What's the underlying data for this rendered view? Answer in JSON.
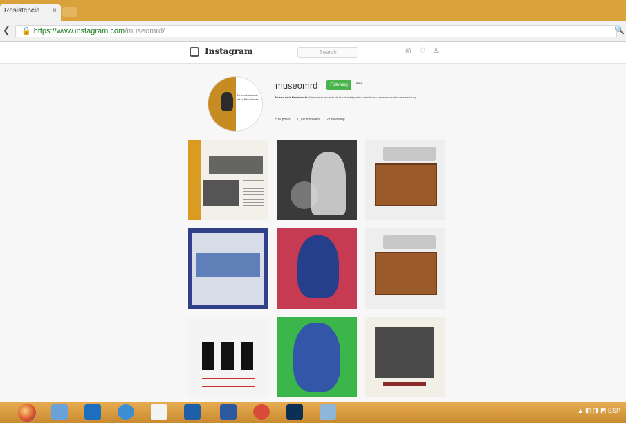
{
  "browser": {
    "tab_title": "Resistencia",
    "tab_close": "×",
    "url_host": "https://www.instagram.com",
    "url_path": "/museomrd/",
    "zoom_glyph": "🔍"
  },
  "instagram": {
    "wordmark": "Instagram",
    "search_placeholder": "Search",
    "nav_icons": [
      "compass-icon",
      "heart-icon",
      "person-icon"
    ],
    "username": "museomrd",
    "follow_label": "Following",
    "more_label": "•••",
    "bio_name": "Museo de la Resistencia",
    "bio_text": "Mantener el recuerdo de la lucha del pueblo dominicano. www.museodelaresistencia.org",
    "stats": {
      "posts": "516 posts",
      "followers": "1,092 followers",
      "following": "27 following"
    },
    "avatar_caption": "Museo Memorial de la Resistencia"
  },
  "taskbar": {
    "apps": [
      "firefox-icon",
      "folder-icon",
      "home-icon",
      "chrome-icon",
      "file-icon",
      "outlook-icon",
      "word-icon",
      "chrome-icon",
      "photoshop-icon",
      "media-icon"
    ],
    "tray_text": "▲ ◧ ◨ ◩ ESP"
  },
  "colors": {
    "tabstrip": "#d9a23a",
    "taskbar": "#c98a30",
    "follow_button": "#4bb34b"
  }
}
